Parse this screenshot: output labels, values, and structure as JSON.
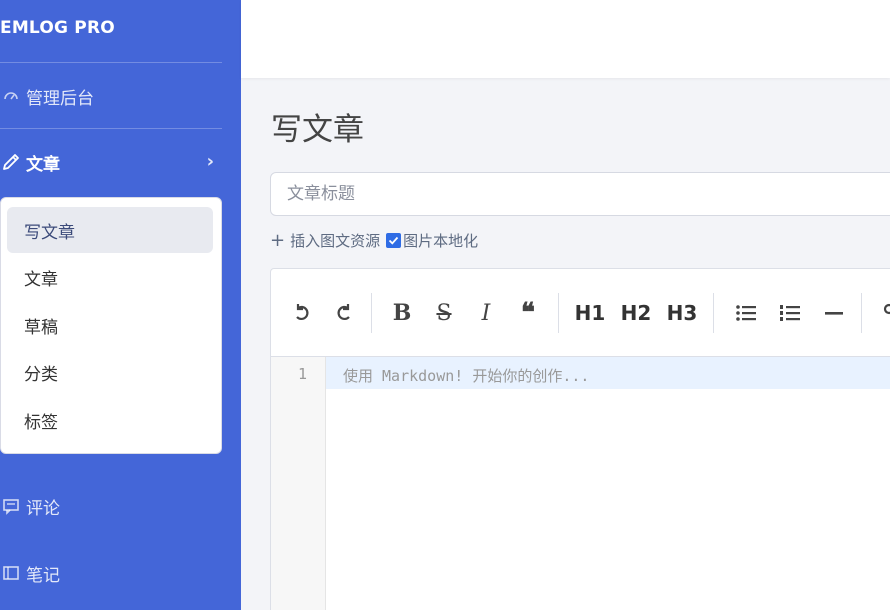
{
  "brand": {
    "name": "EMLOG PRO"
  },
  "sidebar": {
    "dashboard": {
      "label": "管理后台",
      "icon": "dashboard-icon"
    },
    "articles": {
      "label": "文章",
      "icon": "pencil-icon"
    },
    "submenu": [
      {
        "label": "写文章",
        "active": true
      },
      {
        "label": "文章"
      },
      {
        "label": "草稿"
      },
      {
        "label": "分类"
      },
      {
        "label": "标签"
      }
    ],
    "comments": {
      "label": "评论",
      "icon": "comment-icon"
    },
    "notes": {
      "label": "笔记",
      "icon": "note-icon"
    }
  },
  "main": {
    "title": "写文章",
    "title_placeholder": "文章标题",
    "insert_resource_label": "插入图文资源",
    "localize_images_label": "图片本地化",
    "localize_images_checked": true
  },
  "editor": {
    "toolbar": [
      "undo-icon",
      "redo-icon",
      "bold-icon",
      "strikethrough-icon",
      "italic-icon",
      "quote-icon",
      "H1",
      "H2",
      "H3",
      "unordered-list-icon",
      "ordered-list-icon",
      "horizontal-rule-icon",
      "link-icon"
    ],
    "h1_label": "H1",
    "h2_label": "H2",
    "h3_label": "H3",
    "line_number": "1",
    "placeholder": "使用 Markdown! 开始你的创作..."
  },
  "colors": {
    "sidebar": "#4466d8",
    "accent": "#2f6ce5"
  }
}
